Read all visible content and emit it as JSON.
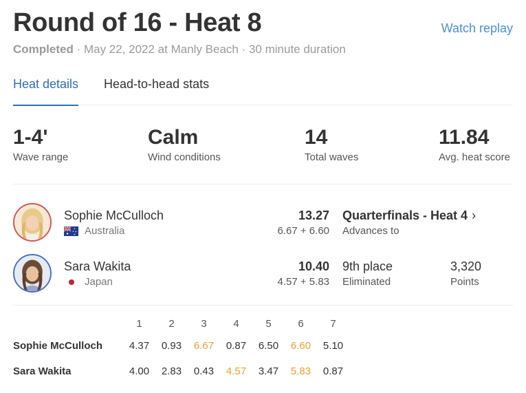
{
  "header": {
    "title": "Round of 16 - Heat 8",
    "watch_replay": "Watch replay",
    "status": "Completed",
    "details": " · May 22, 2022 at Manly Beach · 30 minute duration"
  },
  "tabs": [
    {
      "label": "Heat details",
      "active": true
    },
    {
      "label": "Head-to-head stats",
      "active": false
    }
  ],
  "stats": [
    {
      "value": "1-4'",
      "label": "Wave range"
    },
    {
      "value": "Calm",
      "label": "Wind conditions"
    },
    {
      "value": "14",
      "label": "Total waves"
    },
    {
      "value": "11.84",
      "label": "Avg. heat score"
    }
  ],
  "surfers": [
    {
      "name": "Sophie McCulloch",
      "country": "Australia",
      "score": "13.27",
      "best_waves": "6.67 + 6.60",
      "result": "Quarterfinals - Heat 4",
      "result_sub": "Advances to",
      "points": "",
      "points_label": ""
    },
    {
      "name": "Sara Wakita",
      "country": "Japan",
      "score": "10.40",
      "best_waves": "4.57 + 5.83",
      "result": "9th place",
      "result_sub": "Eliminated",
      "points": "3,320",
      "points_label": "Points"
    }
  ],
  "wave_scores": {
    "columns": [
      "1",
      "2",
      "3",
      "4",
      "5",
      "6",
      "7"
    ],
    "rows": [
      {
        "name": "Sophie McCulloch",
        "scores": [
          "4.37",
          "0.93",
          "6.67",
          "0.87",
          "6.50",
          "6.60",
          "5.10"
        ],
        "highlight": [
          2,
          5
        ]
      },
      {
        "name": "Sara Wakita",
        "scores": [
          "4.00",
          "2.83",
          "0.43",
          "4.57",
          "3.47",
          "5.83",
          "0.87"
        ],
        "highlight": [
          3,
          5
        ]
      }
    ]
  },
  "colors": {
    "accent": "#2f6fb3",
    "link": "#4a90d9",
    "highlight": "#f0a030"
  }
}
